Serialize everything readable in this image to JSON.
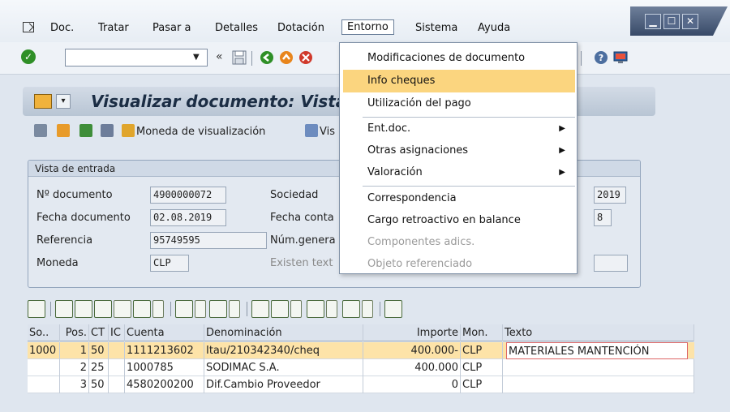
{
  "menu": {
    "items": [
      "Doc.",
      "Tratar",
      "Pasar a",
      "Detalles",
      "Dotación",
      "Entorno",
      "Sistema",
      "Ayuda"
    ],
    "active": "Entorno"
  },
  "toolbar": {
    "ok_symbol": "✓",
    "command_value": "",
    "nav_back": "«"
  },
  "title": {
    "text": "Visualizar documento: Vista"
  },
  "app_toolbar": {
    "currency_label": "Moneda de visualización",
    "view_label": "Vis"
  },
  "group": {
    "title": "Vista de entrada",
    "doc_number_label": "Nº documento",
    "doc_number_value": "4900000072",
    "doc_date_label": "Fecha documento",
    "doc_date_value": "02.08.2019",
    "reference_label": "Referencia",
    "reference_value": "95749595",
    "currency_label": "Moneda",
    "currency_value": "CLP",
    "company_label": "Sociedad",
    "posting_date_label": "Fecha conta",
    "general_num_label": "Núm.genera",
    "text_exists_label": "Existen text",
    "year_value": "2019",
    "period_value": "8"
  },
  "entorno_menu": {
    "items": [
      {
        "label": "Modificaciones de documento",
        "state": "normal",
        "submenu": false
      },
      {
        "label": "Info cheques",
        "state": "selected",
        "submenu": false
      },
      {
        "label": "Utilización del pago",
        "state": "normal",
        "submenu": false
      },
      {
        "label": "Ent.doc.",
        "state": "normal",
        "submenu": true
      },
      {
        "label": "Otras asignaciones",
        "state": "normal",
        "submenu": true
      },
      {
        "label": "Valoración",
        "state": "normal",
        "submenu": true
      },
      {
        "label": "Correspondencia",
        "state": "normal",
        "submenu": false
      },
      {
        "label": "Cargo retroactivo en balance",
        "state": "normal",
        "submenu": false
      },
      {
        "label": "Componentes adics.",
        "state": "disabled",
        "submenu": false
      },
      {
        "label": "Objeto referenciado",
        "state": "disabled",
        "submenu": false
      }
    ]
  },
  "table": {
    "headers": [
      "So..",
      "Pos.",
      "CT",
      "IC",
      "Cuenta",
      "Denominación",
      "Importe",
      "Mon.",
      "Texto"
    ],
    "rows": [
      {
        "so": "1000",
        "pos": "1",
        "ct": "50",
        "ic": "",
        "cuenta": "1111213602",
        "denominacion": "Itau/210342340/cheq",
        "importe": "400.000-",
        "mon": "CLP",
        "texto": "MATERIALES MANTENCIÓN"
      },
      {
        "so": "",
        "pos": "2",
        "ct": "25",
        "ic": "",
        "cuenta": "1000785",
        "denominacion": "SODIMAC S.A.",
        "importe": "400.000",
        "mon": "CLP",
        "texto": ""
      },
      {
        "so": "",
        "pos": "3",
        "ct": "50",
        "ic": "",
        "cuenta": "4580200200",
        "denominacion": "Dif.Cambio Proveedor",
        "importe": "0",
        "mon": "CLP",
        "texto": ""
      }
    ]
  }
}
